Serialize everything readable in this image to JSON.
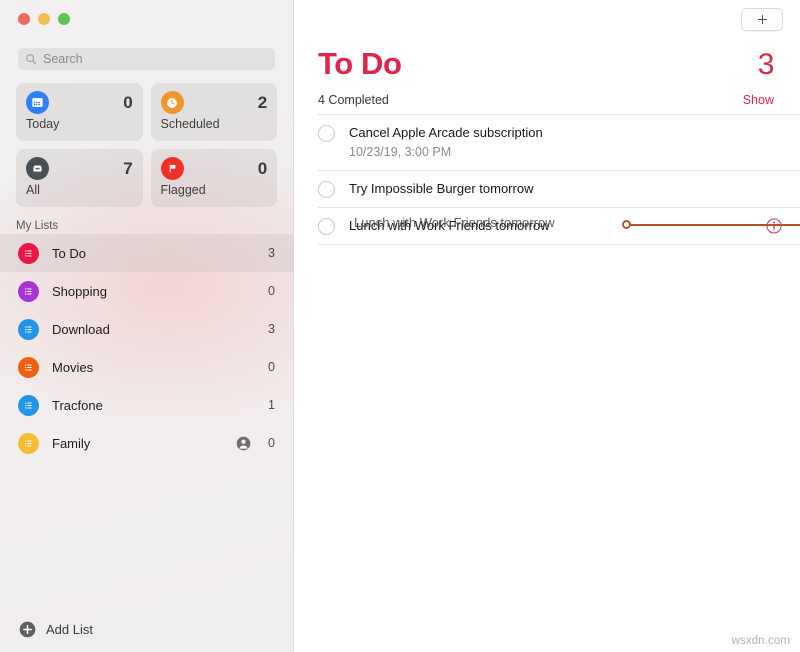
{
  "window": {
    "traffic_lights": [
      {
        "name": "close",
        "color": "#ec6a5f"
      },
      {
        "name": "minimize",
        "color": "#f5bd4f"
      },
      {
        "name": "zoom",
        "color": "#61c454"
      }
    ]
  },
  "sidebar": {
    "search": {
      "placeholder": "Search",
      "value": "",
      "icon": "search-icon"
    },
    "smart_lists": [
      {
        "label": "Today",
        "count": "0",
        "icon": "calendar-icon",
        "color": "#2d7ff9"
      },
      {
        "label": "Scheduled",
        "count": "2",
        "icon": "clock-icon",
        "color": "#f0972a"
      },
      {
        "label": "All",
        "count": "7",
        "icon": "inbox-icon",
        "color": "#4a4f55"
      },
      {
        "label": "Flagged",
        "count": "0",
        "icon": "flag-icon",
        "color": "#f03027"
      }
    ],
    "section_header": "My Lists",
    "lists": [
      {
        "label": "To Do",
        "count": "3",
        "icon": "list-icon",
        "color": "#ec1747",
        "selected": true,
        "shared": false
      },
      {
        "label": "Shopping",
        "count": "0",
        "icon": "list-icon",
        "color": "#a735d6",
        "selected": false,
        "shared": false
      },
      {
        "label": "Download",
        "count": "3",
        "icon": "list-icon",
        "color": "#2196e8",
        "selected": false,
        "shared": false
      },
      {
        "label": "Movies",
        "count": "0",
        "icon": "list-icon",
        "color": "#ef6110",
        "selected": false,
        "shared": false
      },
      {
        "label": "Tracfone",
        "count": "1",
        "icon": "list-icon",
        "color": "#2196e8",
        "selected": false,
        "shared": false
      },
      {
        "label": "Family",
        "count": "0",
        "icon": "list-icon",
        "color": "#f5bd34",
        "selected": false,
        "shared": true
      }
    ],
    "add_list": {
      "label": "Add List",
      "icon": "plus-circle-icon"
    }
  },
  "main": {
    "add_button": {
      "icon": "plus-icon",
      "label": ""
    },
    "title": "To Do",
    "title_color": "#e0244a",
    "count": "3",
    "completed_text": "4 Completed",
    "show_label": "Show",
    "reminders": [
      {
        "title": "Cancel Apple Arcade subscription",
        "subtitle": "10/23/19, 3:00 PM",
        "completed": false,
        "has_info": false,
        "dragging": false
      },
      {
        "title": "Try Impossible Burger tomorrow",
        "subtitle": "",
        "completed": false,
        "has_info": false,
        "dragging": false
      },
      {
        "title": "Lunch with Work Friends tomorrow",
        "subtitle": "",
        "completed": false,
        "has_info": true,
        "dragging": true,
        "drag_ghost_title": "Lunch with Work Friends tomorrow"
      }
    ],
    "drop_indicator": {
      "color": "#b5532b",
      "visible": true
    }
  },
  "watermark": "wsxdn.com"
}
